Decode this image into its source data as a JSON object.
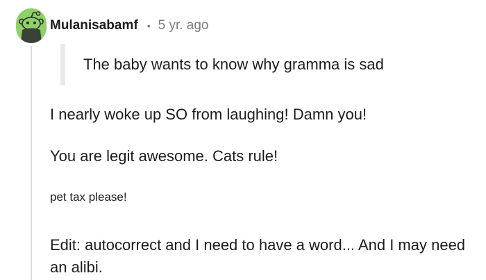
{
  "comment": {
    "avatar_icon": "reddit-snoo-avatar-icon",
    "avatar_color": "#8fd166",
    "username": "Mulanisabamf",
    "separator": "•",
    "timestamp": "5 yr. ago",
    "quote": "The baby wants to know why gramma is sad",
    "paragraphs": [
      "I nearly woke up SO from laughing! Damn you!",
      "You are legit awesome. Cats rule!",
      "pet tax please!",
      "Edit: autocorrect and I need to have a word... And I may need an alibi."
    ]
  }
}
